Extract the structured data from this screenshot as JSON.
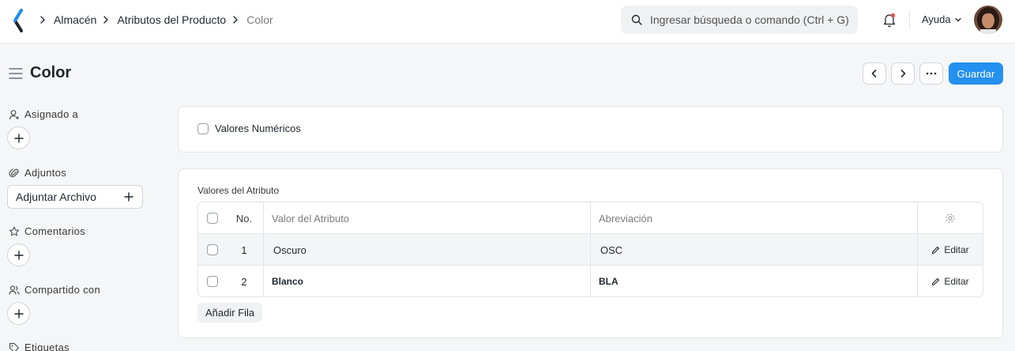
{
  "breadcrumbs": [
    "Almacén",
    "Atributos del Producto",
    "Color"
  ],
  "search": {
    "placeholder": "Ingresar búsqueda o comando (Ctrl + G)"
  },
  "navbar": {
    "help_label": "Ayuda",
    "icons": [
      "app-logo",
      "search-icon",
      "notification-bell-icon",
      "chevron-down-icon",
      "user-avatar"
    ]
  },
  "page": {
    "title": "Color",
    "save_label": "Guardar"
  },
  "sidebar": {
    "assigned_label": "Asignado a",
    "attachments_label": "Adjuntos",
    "attach_button_label": "Adjuntar Archivo",
    "comments_label": "Comentarios",
    "shared_label": "Compartido con",
    "tags_label": "Etiquetas"
  },
  "form": {
    "numeric_values_label": "Valores Numéricos",
    "numeric_values_checked": false,
    "table_label": "Valores del Atributo",
    "columns": {
      "no": "No.",
      "value": "Valor del Atributo",
      "abbr": "Abreviación"
    },
    "rows": [
      {
        "no": "1",
        "value": "Oscuro",
        "abbr": "OSC",
        "action": "Editar"
      },
      {
        "no": "2",
        "value": "Blanco",
        "abbr": "BLA",
        "action": "Editar"
      }
    ],
    "add_row_label": "Añadir Fila"
  },
  "colors": {
    "primary": "#2490ef",
    "background": "#f5f6f7",
    "text": "#1f272e",
    "muted": "#7c7c7c"
  }
}
